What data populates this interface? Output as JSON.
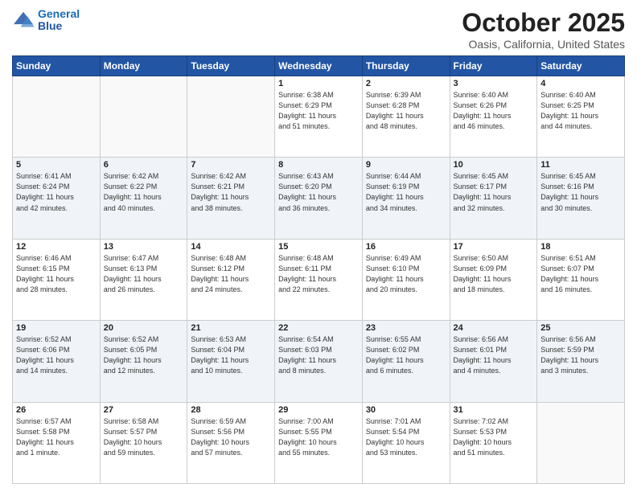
{
  "header": {
    "logo_line1": "General",
    "logo_line2": "Blue",
    "month": "October 2025",
    "location": "Oasis, California, United States"
  },
  "weekdays": [
    "Sunday",
    "Monday",
    "Tuesday",
    "Wednesday",
    "Thursday",
    "Friday",
    "Saturday"
  ],
  "weeks": [
    [
      {
        "day": "",
        "info": ""
      },
      {
        "day": "",
        "info": ""
      },
      {
        "day": "",
        "info": ""
      },
      {
        "day": "1",
        "info": "Sunrise: 6:38 AM\nSunset: 6:29 PM\nDaylight: 11 hours\nand 51 minutes."
      },
      {
        "day": "2",
        "info": "Sunrise: 6:39 AM\nSunset: 6:28 PM\nDaylight: 11 hours\nand 48 minutes."
      },
      {
        "day": "3",
        "info": "Sunrise: 6:40 AM\nSunset: 6:26 PM\nDaylight: 11 hours\nand 46 minutes."
      },
      {
        "day": "4",
        "info": "Sunrise: 6:40 AM\nSunset: 6:25 PM\nDaylight: 11 hours\nand 44 minutes."
      }
    ],
    [
      {
        "day": "5",
        "info": "Sunrise: 6:41 AM\nSunset: 6:24 PM\nDaylight: 11 hours\nand 42 minutes."
      },
      {
        "day": "6",
        "info": "Sunrise: 6:42 AM\nSunset: 6:22 PM\nDaylight: 11 hours\nand 40 minutes."
      },
      {
        "day": "7",
        "info": "Sunrise: 6:42 AM\nSunset: 6:21 PM\nDaylight: 11 hours\nand 38 minutes."
      },
      {
        "day": "8",
        "info": "Sunrise: 6:43 AM\nSunset: 6:20 PM\nDaylight: 11 hours\nand 36 minutes."
      },
      {
        "day": "9",
        "info": "Sunrise: 6:44 AM\nSunset: 6:19 PM\nDaylight: 11 hours\nand 34 minutes."
      },
      {
        "day": "10",
        "info": "Sunrise: 6:45 AM\nSunset: 6:17 PM\nDaylight: 11 hours\nand 32 minutes."
      },
      {
        "day": "11",
        "info": "Sunrise: 6:45 AM\nSunset: 6:16 PM\nDaylight: 11 hours\nand 30 minutes."
      }
    ],
    [
      {
        "day": "12",
        "info": "Sunrise: 6:46 AM\nSunset: 6:15 PM\nDaylight: 11 hours\nand 28 minutes."
      },
      {
        "day": "13",
        "info": "Sunrise: 6:47 AM\nSunset: 6:13 PM\nDaylight: 11 hours\nand 26 minutes."
      },
      {
        "day": "14",
        "info": "Sunrise: 6:48 AM\nSunset: 6:12 PM\nDaylight: 11 hours\nand 24 minutes."
      },
      {
        "day": "15",
        "info": "Sunrise: 6:48 AM\nSunset: 6:11 PM\nDaylight: 11 hours\nand 22 minutes."
      },
      {
        "day": "16",
        "info": "Sunrise: 6:49 AM\nSunset: 6:10 PM\nDaylight: 11 hours\nand 20 minutes."
      },
      {
        "day": "17",
        "info": "Sunrise: 6:50 AM\nSunset: 6:09 PM\nDaylight: 11 hours\nand 18 minutes."
      },
      {
        "day": "18",
        "info": "Sunrise: 6:51 AM\nSunset: 6:07 PM\nDaylight: 11 hours\nand 16 minutes."
      }
    ],
    [
      {
        "day": "19",
        "info": "Sunrise: 6:52 AM\nSunset: 6:06 PM\nDaylight: 11 hours\nand 14 minutes."
      },
      {
        "day": "20",
        "info": "Sunrise: 6:52 AM\nSunset: 6:05 PM\nDaylight: 11 hours\nand 12 minutes."
      },
      {
        "day": "21",
        "info": "Sunrise: 6:53 AM\nSunset: 6:04 PM\nDaylight: 11 hours\nand 10 minutes."
      },
      {
        "day": "22",
        "info": "Sunrise: 6:54 AM\nSunset: 6:03 PM\nDaylight: 11 hours\nand 8 minutes."
      },
      {
        "day": "23",
        "info": "Sunrise: 6:55 AM\nSunset: 6:02 PM\nDaylight: 11 hours\nand 6 minutes."
      },
      {
        "day": "24",
        "info": "Sunrise: 6:56 AM\nSunset: 6:01 PM\nDaylight: 11 hours\nand 4 minutes."
      },
      {
        "day": "25",
        "info": "Sunrise: 6:56 AM\nSunset: 5:59 PM\nDaylight: 11 hours\nand 3 minutes."
      }
    ],
    [
      {
        "day": "26",
        "info": "Sunrise: 6:57 AM\nSunset: 5:58 PM\nDaylight: 11 hours\nand 1 minute."
      },
      {
        "day": "27",
        "info": "Sunrise: 6:58 AM\nSunset: 5:57 PM\nDaylight: 10 hours\nand 59 minutes."
      },
      {
        "day": "28",
        "info": "Sunrise: 6:59 AM\nSunset: 5:56 PM\nDaylight: 10 hours\nand 57 minutes."
      },
      {
        "day": "29",
        "info": "Sunrise: 7:00 AM\nSunset: 5:55 PM\nDaylight: 10 hours\nand 55 minutes."
      },
      {
        "day": "30",
        "info": "Sunrise: 7:01 AM\nSunset: 5:54 PM\nDaylight: 10 hours\nand 53 minutes."
      },
      {
        "day": "31",
        "info": "Sunrise: 7:02 AM\nSunset: 5:53 PM\nDaylight: 10 hours\nand 51 minutes."
      },
      {
        "day": "",
        "info": ""
      }
    ]
  ]
}
